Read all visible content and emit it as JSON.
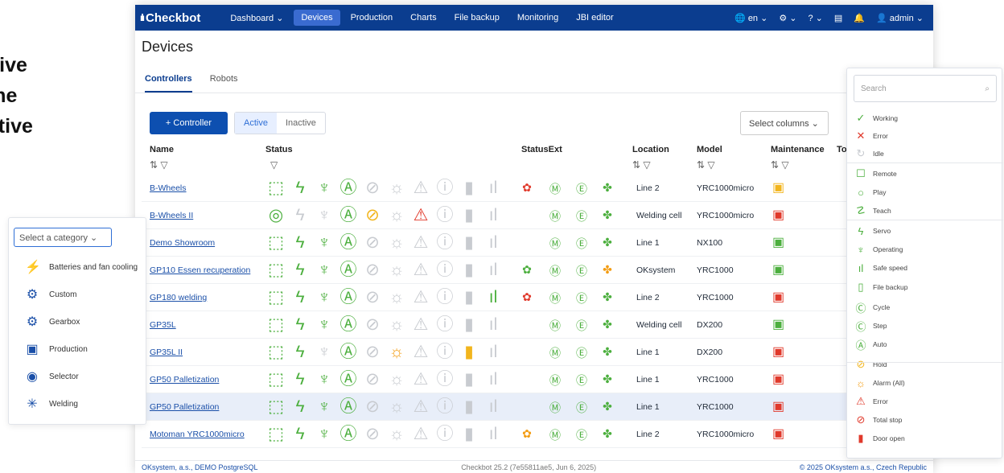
{
  "promo": {
    "lines": [
      "nsive",
      "time",
      "lictive"
    ]
  },
  "app": {
    "logo": "Checkbot",
    "logo_bars": "ılı"
  },
  "nav": [
    "Dashboard ⌄",
    "Devices",
    "Production",
    "Charts",
    "File backup",
    "Monitoring",
    "JBI editor"
  ],
  "topright": {
    "lang": "en",
    "user": "admin"
  },
  "page": {
    "title": "Devices"
  },
  "tabs": [
    "Controllers",
    "Robots"
  ],
  "toolbar": {
    "add_label": "+ Controller",
    "active": "Active",
    "inactive": "Inactive",
    "select_columns": "Select columns"
  },
  "columns": {
    "name": "Name",
    "status": "Status",
    "statusext": "StatusExt",
    "location": "Location",
    "model": "Model",
    "maintenance": "Maintenance",
    "to": "To"
  },
  "rows": [
    {
      "name": "B-Wheels",
      "location": "Line 2",
      "model": "YRC1000micro",
      "maint": "y"
    },
    {
      "name": "B-Wheels II",
      "location": "Welding cell",
      "model": "YRC1000micro",
      "maint": "r"
    },
    {
      "name": "Demo Showroom",
      "location": "Line 1",
      "model": "NX100",
      "maint": "g"
    },
    {
      "name": "GP110 Essen recuperation",
      "location": "OKsystem",
      "model": "YRC1000",
      "maint": "g"
    },
    {
      "name": "GP180 welding",
      "location": "Line 2",
      "model": "YRC1000",
      "maint": "r"
    },
    {
      "name": "GP35L",
      "location": "Welding cell",
      "model": "DX200",
      "maint": "g"
    },
    {
      "name": "GP35L II",
      "location": "Line 1",
      "model": "DX200",
      "maint": "r"
    },
    {
      "name": "GP50 Palletization",
      "location": "Line 1",
      "model": "YRC1000",
      "maint": "r"
    },
    {
      "name": "GP50 Palletization",
      "location": "Line 1",
      "model": "YRC1000",
      "maint": "r"
    },
    {
      "name": "Motoman YRC1000micro",
      "location": "Line 2",
      "model": "YRC1000micro",
      "maint": "r"
    }
  ],
  "footer": {
    "left": "OKsystem, a.s., DEMO PostgreSQL",
    "mid": "Checkbot  25.2 (7e55811ae5, Jun 6, 2025)",
    "right": "© 2025 OKsystem a.s., Czech Republic"
  },
  "category": {
    "placeholder": "Select a category",
    "items": [
      "Batteries and fan cooling",
      "Custom",
      "Gearbox",
      "Production",
      "Selector",
      "Welding"
    ]
  },
  "status_panel": {
    "search": "Search",
    "items": [
      "Working",
      "Error",
      "Idle",
      "Remote",
      "Play",
      "Teach",
      "Servo",
      "Operating",
      "Safe speed",
      "File backup",
      "Cycle",
      "Step",
      "Auto",
      "Hold",
      "Alarm (All)",
      "Error",
      "Total stop",
      "Door open"
    ]
  }
}
